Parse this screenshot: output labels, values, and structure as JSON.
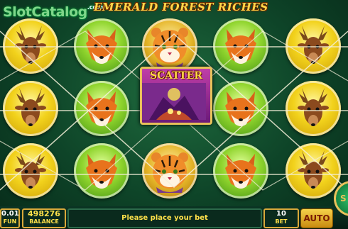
{
  "watermark": {
    "text": "SlotCatalog",
    "suffix": ".com"
  },
  "title": "EMERALD FOREST RICHES",
  "reels": [
    [
      "deer",
      "deer",
      "deer"
    ],
    [
      "fox",
      "fox",
      "fox"
    ],
    [
      "tiger",
      "scatter",
      "tiger"
    ],
    [
      "fox",
      "fox",
      "fox"
    ],
    [
      "deer",
      "deer",
      "deer"
    ]
  ],
  "scatter_label": "SCATTER",
  "bottom": {
    "fun_value": "0.01",
    "fun_label": "FUN",
    "balance_value": "498276",
    "balance_label": "BALANCE",
    "message": "Please place your bet",
    "bet_value": "10",
    "bet_label": "BET",
    "auto_label": "AUTO",
    "spin_label": "S"
  },
  "colors": {
    "title": "#ffd84a",
    "accent": "#d9a93a",
    "message": "#ffe14a"
  }
}
